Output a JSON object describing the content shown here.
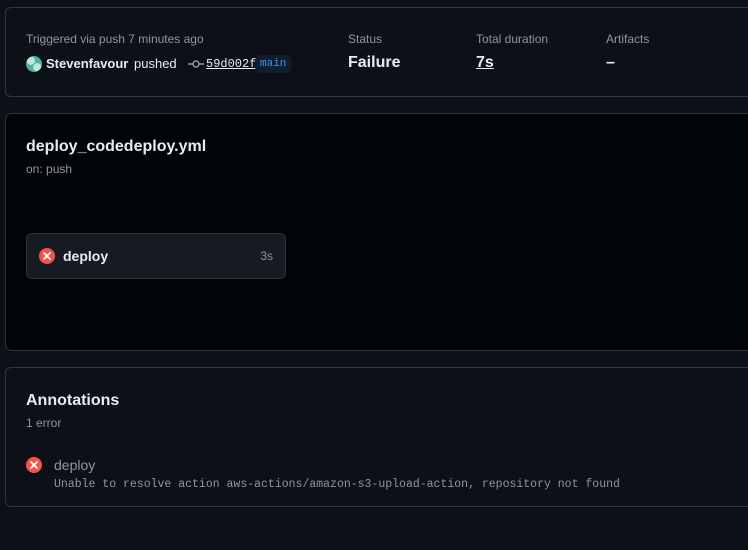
{
  "summary": {
    "trigger_text": "Triggered via push 7 minutes ago",
    "user": "Stevenfavour",
    "action": "pushed",
    "commit_sha": "59d002f",
    "branch": "main",
    "status_label": "Status",
    "status_value": "Failure",
    "duration_label": "Total duration",
    "duration_value": "7s",
    "artifacts_label": "Artifacts",
    "artifacts_value": "–"
  },
  "workflow": {
    "file": "deploy_codedeploy.yml",
    "trigger": "on: push",
    "jobs": [
      {
        "name": "deploy",
        "duration": "3s",
        "status": "failure"
      }
    ]
  },
  "annotations": {
    "title": "Annotations",
    "count": "1 error",
    "items": [
      {
        "job": "deploy",
        "message": "Unable to resolve action aws-actions/amazon-s3-upload-action, repository not found",
        "level": "error"
      }
    ]
  },
  "colors": {
    "error": "#f85149",
    "branch": "#4493f8",
    "background": "#0d1117"
  }
}
